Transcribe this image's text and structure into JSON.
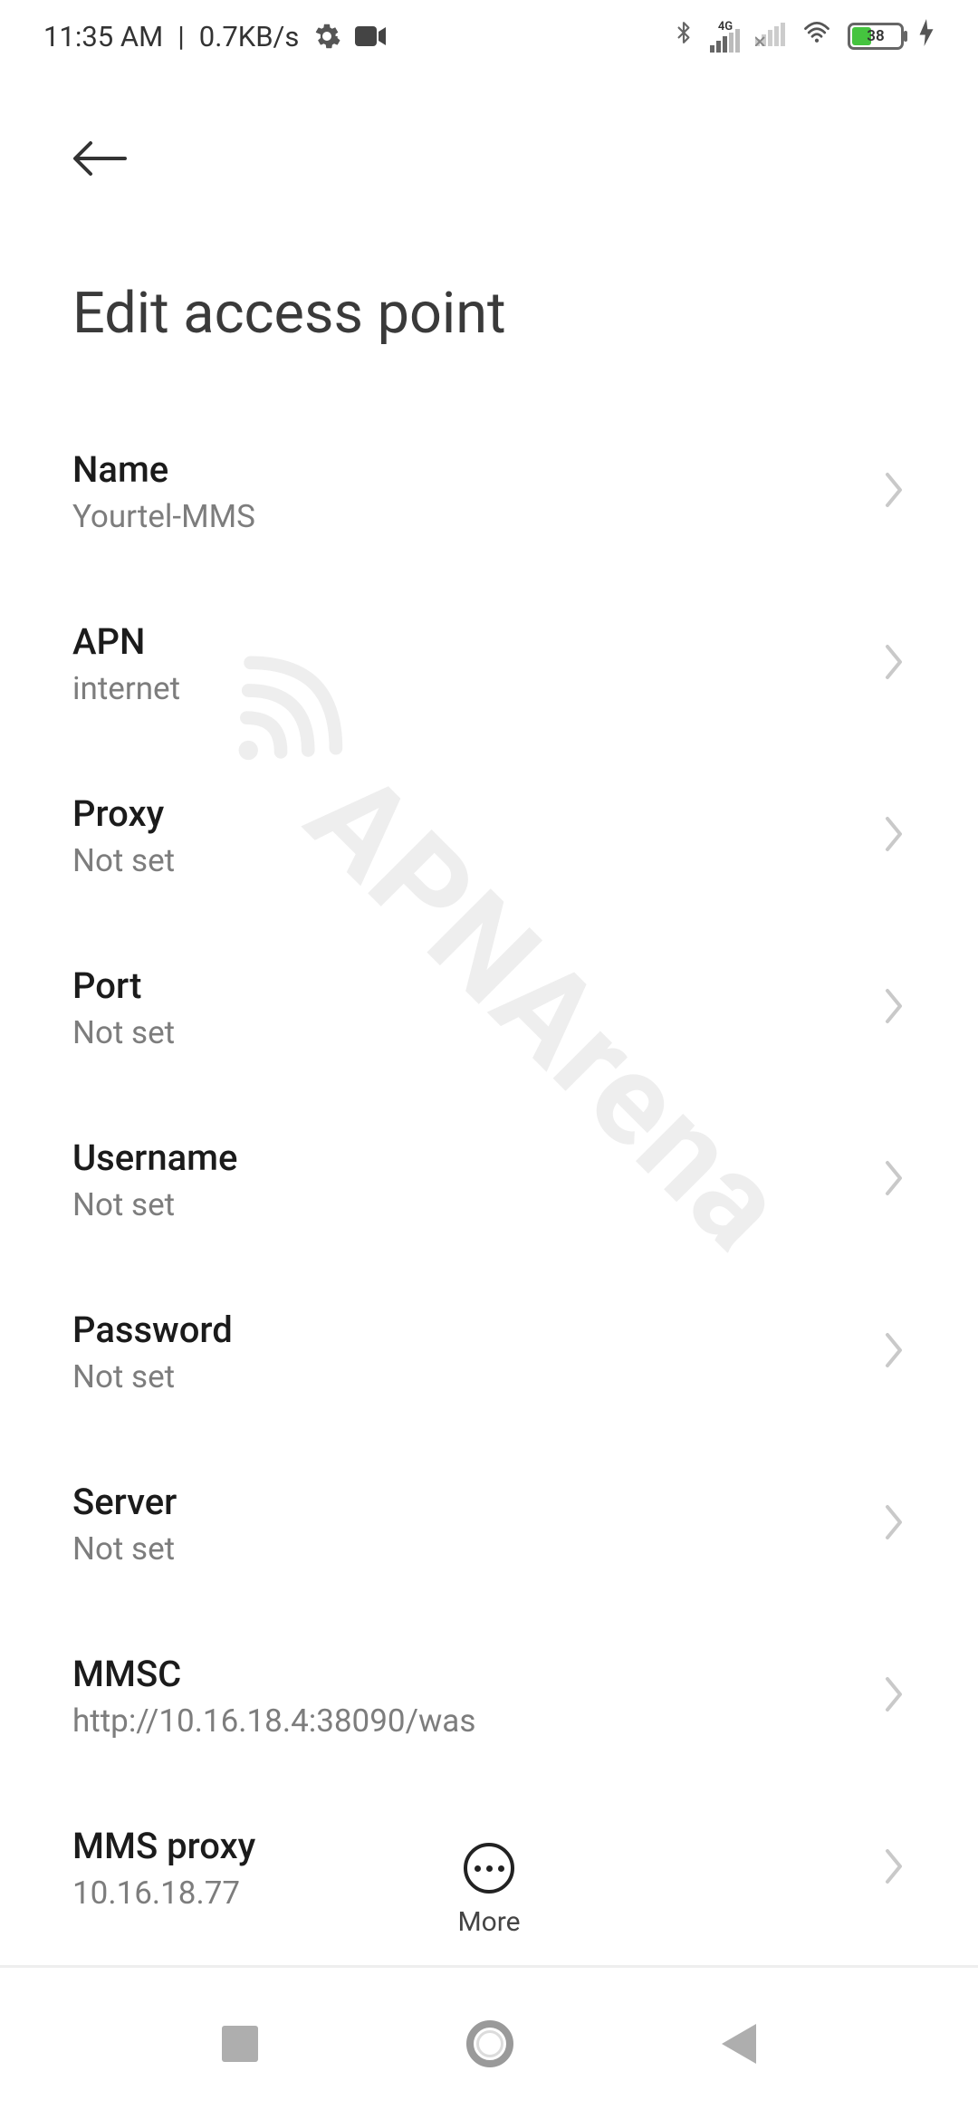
{
  "watermark_text": "APNArena",
  "status": {
    "time": "11:35 AM",
    "net_speed": "0.7KB/s",
    "network_badge": "4G",
    "battery_percent": 38
  },
  "header": {
    "title": "Edit access point"
  },
  "bottom_action": {
    "label": "More"
  },
  "rows": [
    {
      "key": "name",
      "label": "Name",
      "value": "Yourtel-MMS"
    },
    {
      "key": "apn",
      "label": "APN",
      "value": "internet"
    },
    {
      "key": "proxy",
      "label": "Proxy",
      "value": "Not set"
    },
    {
      "key": "port",
      "label": "Port",
      "value": "Not set"
    },
    {
      "key": "username",
      "label": "Username",
      "value": "Not set"
    },
    {
      "key": "password",
      "label": "Password",
      "value": "Not set"
    },
    {
      "key": "server",
      "label": "Server",
      "value": "Not set"
    },
    {
      "key": "mmsc",
      "label": "MMSC",
      "value": "http://10.16.18.4:38090/was"
    },
    {
      "key": "mmsproxy",
      "label": "MMS proxy",
      "value": "10.16.18.77"
    }
  ]
}
